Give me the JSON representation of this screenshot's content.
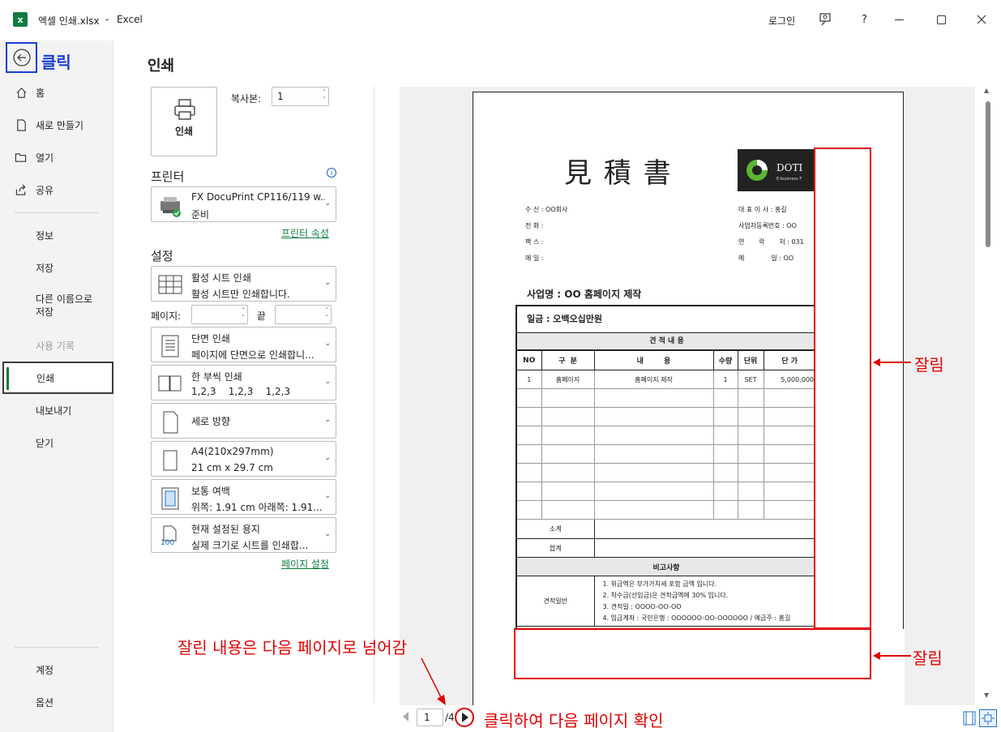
{
  "titlebar": {
    "file": "엑셀 인쇄.xlsx",
    "sep": "-",
    "app": "Excel",
    "login": "로그인",
    "help": "?"
  },
  "sidebar": {
    "back_annotation": "클릭",
    "home": "홈",
    "new": "새로 만들기",
    "open": "열기",
    "share": "공유",
    "info": "정보",
    "save": "저장",
    "save_as": "다른 이름으로\n저장",
    "history": "사용 기록",
    "print": "인쇄",
    "export": "내보내기",
    "close": "닫기",
    "account": "계정",
    "options": "옵션"
  },
  "print_panel": {
    "title": "인쇄",
    "print_button": "인쇄",
    "copies_label": "복사본:",
    "copies_value": "1",
    "printer_heading": "프린터",
    "printer_name": "FX DocuPrint CP116/119 w...",
    "printer_status": "준비",
    "printer_props": "프린터 속성",
    "settings_heading": "설정",
    "scope_title": "활성 시트 인쇄",
    "scope_sub": "활성 시트만 인쇄합니다.",
    "pages_label": "페이지:",
    "pages_to": "끝",
    "sides_title": "단면 인쇄",
    "sides_sub": "페이지에 단면으로 인쇄합니...",
    "collate_title": "한 부씩 인쇄",
    "collate_sub": "1,2,3    1,2,3    1,2,3",
    "orientation_title": "세로 방향",
    "paper_title": "A4(210x297mm)",
    "paper_sub": "21 cm x 29.7 cm",
    "margin_title": "보통 여백",
    "margin_sub": "위쪽: 1.91 cm 아래쪽: 1.91...",
    "scale_title": "현재 설정된 용지",
    "scale_sub": "실제 크기로 시트를 인쇄합...",
    "scale_icon_text": "100",
    "page_setup": "페이지 설정"
  },
  "preview": {
    "doc_title": "見 積 書",
    "logo_text": "DOTI",
    "logo_sub": "E-business F",
    "left_info": [
      "수 신 : OO회사",
      "전 화 :",
      "팩 스 :",
      "메 일 :"
    ],
    "right_info": [
      "대 표 이 사 : 홍길",
      "사업자등록번호 : OO",
      "연       락       처 : 031",
      "메             일 : OO"
    ],
    "project": "사업명 : OO 홈페이지 제작",
    "amount": "일금 : 오백오십만원",
    "section": "견 적 내 용",
    "columns": [
      "NO",
      "구  분",
      "내        용",
      "수량",
      "단위",
      "단 가"
    ],
    "row1": [
      "1",
      "홈페이지",
      "홈페이지 제작",
      "1",
      "SET",
      "5,000,000"
    ],
    "subtotal": "소계",
    "total": "합계",
    "notes_header": "비고사항",
    "notes_label": "견적일반",
    "notes": [
      "1. 위금액은 부가가치세 포함 금액 입니다.",
      "2. 착수금(선입금)은 견적금액에 30% 입니다.",
      "3. 견적일 : OOOO-OO-OO",
      "4. 입금계좌 : 국민은행 : OOOOOO-OO-OOOOOO  / 예금주 : 홍길"
    ],
    "page_current": "1",
    "page_total": "/4"
  },
  "annotations": {
    "cut_right": "잘림",
    "cut_bottom": "잘림",
    "overflow_note": "잘린 내용은 다음 페이지로 넘어감",
    "next_note": "클릭하여 다음 페이지 확인"
  },
  "colors": {
    "accent": "#107c41",
    "annotation_red": "#e00000",
    "annotation_blue": "#1a3fd1"
  }
}
